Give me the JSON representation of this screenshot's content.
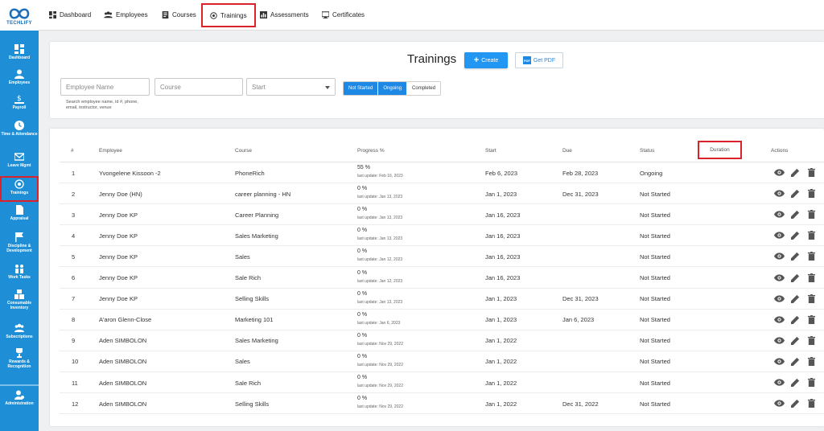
{
  "app": {
    "logo_text": "TECHLIFY"
  },
  "topnav": [
    {
      "label": "Dashboard",
      "icon": "dashboard-icon"
    },
    {
      "label": "Employees",
      "icon": "people-icon"
    },
    {
      "label": "Courses",
      "icon": "course-icon"
    },
    {
      "label": "Trainings",
      "icon": "training-icon",
      "active": true
    },
    {
      "label": "Assessments",
      "icon": "chart-icon"
    },
    {
      "label": "Certificates",
      "icon": "certificate-icon"
    }
  ],
  "sidebar": [
    {
      "label": "Dashboard",
      "icon": "dashboard-icon"
    },
    {
      "label": "Employees",
      "icon": "person-icon"
    },
    {
      "label": "Payroll",
      "icon": "payroll-icon"
    },
    {
      "label": "Time & Attendance",
      "icon": "clock-icon"
    },
    {
      "label": "Leave Mgmt",
      "icon": "envelope-icon"
    },
    {
      "label": "Trainings",
      "icon": "training-icon",
      "active": true
    },
    {
      "label": "Appraisal",
      "icon": "document-icon"
    },
    {
      "label": "Discipline & Development",
      "icon": "flag-icon"
    },
    {
      "label": "Work Tasks",
      "icon": "team-icon"
    },
    {
      "label": "Consumable Inventory",
      "icon": "inventory-icon"
    },
    {
      "label": "Subscriptions",
      "icon": "group-icon"
    },
    {
      "label": "Rewards & Recognition",
      "icon": "trophy-icon"
    },
    {
      "label": "Administration",
      "icon": "admin-icon"
    }
  ],
  "page": {
    "title": "Trainings",
    "create_label": "Create",
    "pdf_label": "Get PDF"
  },
  "filters": {
    "employee_placeholder": "Employee Name",
    "course_placeholder": "Course",
    "start_placeholder": "Start",
    "hint": "Search employee name, id #, phone, email, instructor, venue",
    "status_options": [
      "Not Started",
      "Ongoing",
      "Completed"
    ],
    "status_selected": [
      "Not Started",
      "Ongoing"
    ]
  },
  "table": {
    "headers": {
      "num": "#",
      "employee": "Employee",
      "course": "Course",
      "progress": "Progress %",
      "start": "Start",
      "due": "Due",
      "status": "Status",
      "duration": "Duration",
      "actions": "Actions"
    },
    "rows": [
      {
        "num": "1",
        "employee": "Yvongelene Kissoon -2",
        "course": "PhoneRich",
        "progress": "55 %",
        "updated": "last update: Feb 16, 2023",
        "start": "Feb 6, 2023",
        "due": "Feb 28, 2023",
        "status": "Ongoing"
      },
      {
        "num": "2",
        "employee": "Jenny Doe (HN)",
        "course": "career planning - HN",
        "progress": "0 %",
        "updated": "last update: Jan 13, 2023",
        "start": "Jan 1, 2023",
        "due": "Dec 31, 2023",
        "status": "Not Started"
      },
      {
        "num": "3",
        "employee": "Jenny Doe KP",
        "course": "Career Planning",
        "progress": "0 %",
        "updated": "last update: Jan 13, 2023",
        "start": "Jan 16, 2023",
        "due": "",
        "status": "Not Started"
      },
      {
        "num": "4",
        "employee": "Jenny Doe KP",
        "course": "Sales Marketing",
        "progress": "0 %",
        "updated": "last update: Jan 13, 2023",
        "start": "Jan 16, 2023",
        "due": "",
        "status": "Not Started"
      },
      {
        "num": "5",
        "employee": "Jenny Doe KP",
        "course": "Sales",
        "progress": "0 %",
        "updated": "last update: Jan 12, 2023",
        "start": "Jan 16, 2023",
        "due": "",
        "status": "Not Started"
      },
      {
        "num": "6",
        "employee": "Jenny Doe KP",
        "course": "Sale Rich",
        "progress": "0 %",
        "updated": "last update: Jan 12, 2023",
        "start": "Jan 16, 2023",
        "due": "",
        "status": "Not Started"
      },
      {
        "num": "7",
        "employee": "Jenny Doe KP",
        "course": "Selling Skills",
        "progress": "0 %",
        "updated": "last update: Jan 13, 2023",
        "start": "Jan 1, 2023",
        "due": "Dec 31, 2023",
        "status": "Not Started"
      },
      {
        "num": "8",
        "employee": "A'aron Glenn-Close",
        "course": "Marketing 101",
        "progress": "0 %",
        "updated": "last update: Jan 6, 2023",
        "start": "Jan 1, 2023",
        "due": "Jan 6, 2023",
        "status": "Not Started"
      },
      {
        "num": "9",
        "employee": "Aden SIMBOLON",
        "course": "Sales Marketing",
        "progress": "0 %",
        "updated": "last update: Nov 29, 2022",
        "start": "Jan 1, 2022",
        "due": "",
        "status": "Not Started"
      },
      {
        "num": "10",
        "employee": "Aden SIMBOLON",
        "course": "Sales",
        "progress": "0 %",
        "updated": "last update: Nov 29, 2022",
        "start": "Jan 1, 2022",
        "due": "",
        "status": "Not Started"
      },
      {
        "num": "11",
        "employee": "Aden SIMBOLON",
        "course": "Sale Rich",
        "progress": "0 %",
        "updated": "last update: Nov 29, 2022",
        "start": "Jan 1, 2022",
        "due": "",
        "status": "Not Started"
      },
      {
        "num": "12",
        "employee": "Aden SIMBOLON",
        "course": "Selling Skills",
        "progress": "0 %",
        "updated": "last update: Nov 29, 2022",
        "start": "Jan 1, 2022",
        "due": "Dec 31, 2022",
        "status": "Not Started"
      }
    ]
  },
  "colors": {
    "brand": "#1e8fd6",
    "primary_button": "#2196f3",
    "highlight": "#d9222a"
  }
}
